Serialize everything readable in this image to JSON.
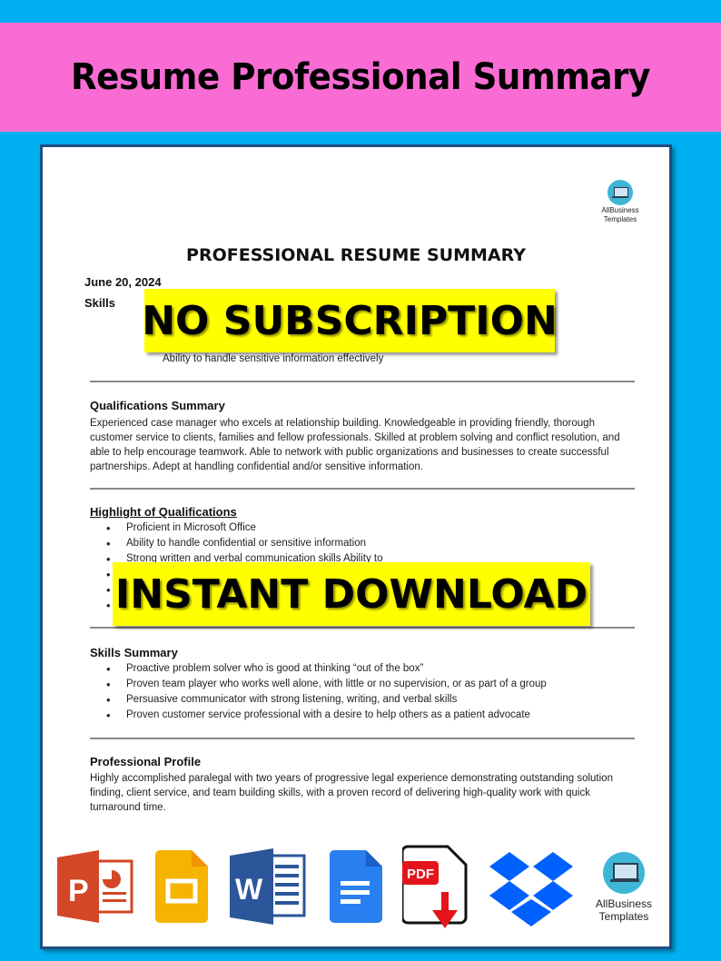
{
  "banner": {
    "title": "Resume Professional Summary"
  },
  "colors": {
    "background": "#00b0f0",
    "banner": "#f86cd4",
    "stamp": "#ffff00",
    "frame": "#1f4e82"
  },
  "document": {
    "logo_text": [
      "AllBusiness",
      "Templates"
    ],
    "title": "PROFESSIONAL RESUME SUMMARY",
    "date": "June 20, 2024",
    "skills_label": "Skills",
    "skills_line": "Ability to handle sensitive information effectively",
    "sections": {
      "qualifications_summary": {
        "heading": "Qualifications Summary",
        "text": "Experienced case manager who excels at relationship building.  Knowledgeable in providing friendly, thorough customer service to clients, families and fellow professionals.  Skilled at problem solving and conflict resolution, and able to help encourage teamwork.  Able to network with public organizations and businesses to create successful partnerships.  Adept at handling confidential and/or sensitive information."
      },
      "highlights": {
        "heading": "Highlight of Qualifications",
        "items": [
          "Proficient in Microsoft Office",
          "Ability to handle confidential or sensitive information",
          "Strong written and verbal communication skills Ability to",
          "",
          "",
          ""
        ]
      },
      "skills_summary": {
        "heading": "Skills Summary",
        "items": [
          "Proactive problem solver who is good at thinking “out of the box”",
          "Proven team player who works well alone, with little or no supervision, or as part of a group",
          "Persuasive communicator with strong listening, writing, and verbal skills",
          "Proven customer service professional with a desire to help others as a patient advocate"
        ]
      },
      "professional_profile": {
        "heading": "Professional Profile",
        "text": "Highly accomplished paralegal with two years of progressive legal experience demonstrating outstanding solution finding, client service, and team building skills, with a proven record of delivering high-quality work with quick turnaround time."
      }
    }
  },
  "stamps": {
    "no_subscription": "NO SUBSCRIPTION",
    "instant_download": "INSTANT DOWNLOAD"
  },
  "format_icons": [
    {
      "name": "powerpoint-icon",
      "letter": "P"
    },
    {
      "name": "google-slides-icon"
    },
    {
      "name": "word-icon",
      "letter": "W"
    },
    {
      "name": "google-docs-icon"
    },
    {
      "name": "pdf-download-icon",
      "label": "PDF"
    },
    {
      "name": "dropbox-icon"
    },
    {
      "name": "allbusiness-templates-logo",
      "label": [
        "AllBusiness",
        "Templates"
      ]
    }
  ]
}
